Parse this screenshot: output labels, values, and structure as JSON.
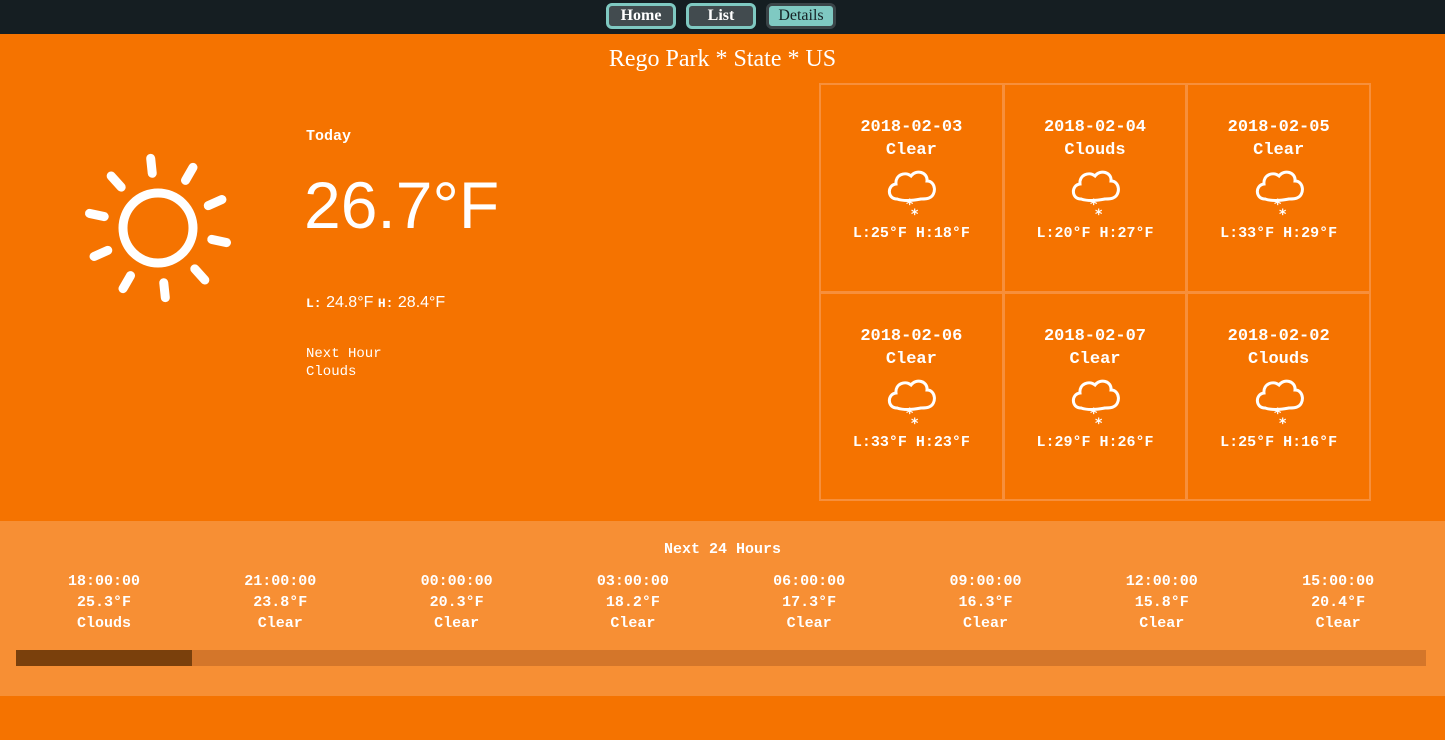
{
  "nav": {
    "items": [
      "Home",
      "List",
      "Details"
    ],
    "active": "Details"
  },
  "location": "Rego Park * State * US",
  "today": {
    "label": "Today",
    "temp": "26.7°F",
    "low_key": "L:",
    "low": "24.8°F",
    "high_key": "H:",
    "high": "28.4°F",
    "next_hour_label": "Next Hour",
    "next_hour_condition": "Clouds",
    "icon": "sun-icon"
  },
  "forecast": [
    {
      "date": "2018-02-03",
      "condition": "Clear",
      "range": "L:25°F H:18°F",
      "icon": "cloud-snow-icon"
    },
    {
      "date": "2018-02-04",
      "condition": "Clouds",
      "range": "L:20°F H:27°F",
      "icon": "cloud-snow-icon"
    },
    {
      "date": "2018-02-05",
      "condition": "Clear",
      "range": "L:33°F H:29°F",
      "icon": "cloud-snow-icon"
    },
    {
      "date": "2018-02-06",
      "condition": "Clear",
      "range": "L:33°F H:23°F",
      "icon": "cloud-snow-icon"
    },
    {
      "date": "2018-02-07",
      "condition": "Clear",
      "range": "L:29°F H:26°F",
      "icon": "cloud-snow-icon"
    },
    {
      "date": "2018-02-02",
      "condition": "Clouds",
      "range": "L:25°F H:16°F",
      "icon": "cloud-snow-icon"
    }
  ],
  "hourly": {
    "title": "Next 24 Hours",
    "items": [
      {
        "time": "18:00:00",
        "temp": "25.3°F",
        "condition": "Clouds"
      },
      {
        "time": "21:00:00",
        "temp": "23.8°F",
        "condition": "Clear"
      },
      {
        "time": "00:00:00",
        "temp": "20.3°F",
        "condition": "Clear"
      },
      {
        "time": "03:00:00",
        "temp": "18.2°F",
        "condition": "Clear"
      },
      {
        "time": "06:00:00",
        "temp": "17.3°F",
        "condition": "Clear"
      },
      {
        "time": "09:00:00",
        "temp": "16.3°F",
        "condition": "Clear"
      },
      {
        "time": "12:00:00",
        "temp": "15.8°F",
        "condition": "Clear"
      },
      {
        "time": "15:00:00",
        "temp": "20.4°F",
        "condition": "Clear"
      }
    ],
    "scroll_position": 0.125
  },
  "colors": {
    "background": "#f57300",
    "hourly_panel": "#f78f34",
    "nav_bar": "#151e22",
    "nav_accent": "#7fc9c2",
    "scroll_thumb": "#7a400c"
  }
}
